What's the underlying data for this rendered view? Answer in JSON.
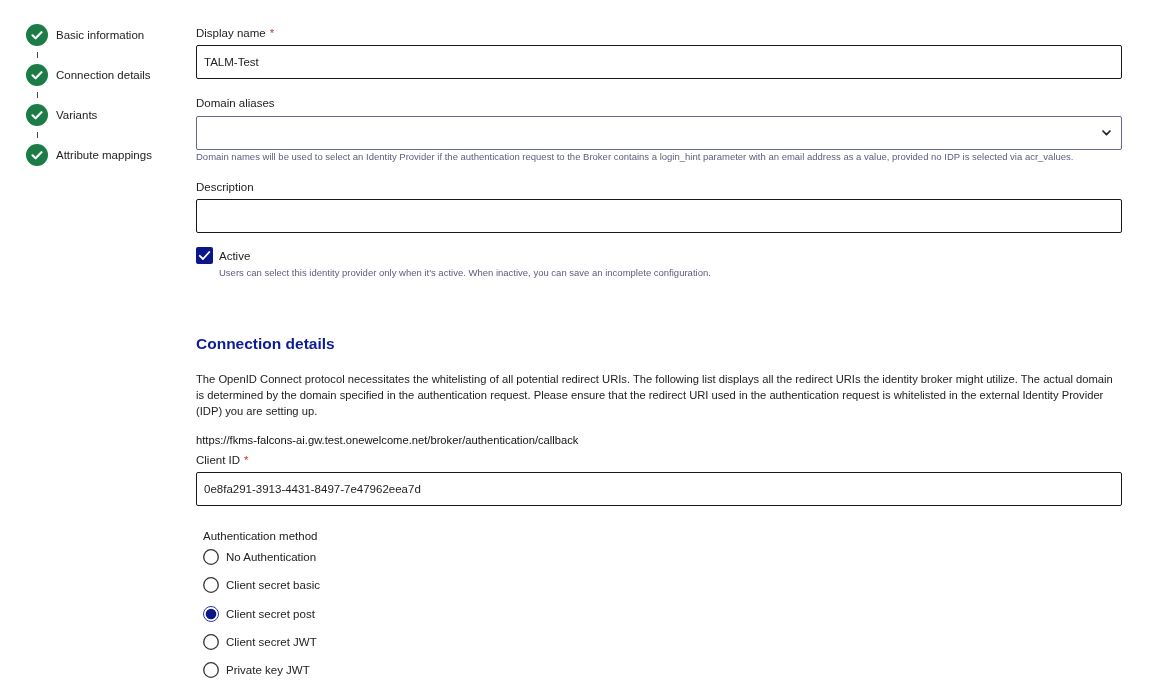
{
  "stepper": {
    "steps": [
      {
        "label": "Basic information",
        "completed": true
      },
      {
        "label": "Connection details",
        "completed": true
      },
      {
        "label": "Variants",
        "completed": true
      },
      {
        "label": "Attribute mappings",
        "completed": true
      }
    ]
  },
  "basic_information": {
    "fields": [
      {
        "kind": "text",
        "label": "Display name",
        "required_mark": "*",
        "value": "TALM-Test"
      },
      {
        "kind": "select",
        "label": "Domain aliases",
        "hint": "Domain names will be used to select an Identity Provider if the authentication request to the Broker contains a login_hint parameter with an email address as a value, provided no IDP is selected via acr_values."
      },
      {
        "kind": "text",
        "label": "Description"
      }
    ],
    "active": {
      "label": "Active",
      "checked": true,
      "hint": "Users can select this identity provider only when it's active. When inactive, you can save an incomplete configuration."
    }
  },
  "connection_details": {
    "heading": "Connection details",
    "description": "The OpenID Connect protocol necessitates the whitelisting of all potential redirect URIs. The following list displays all the redirect URIs the identity broker might utilize. The actual domain is determined by the domain specified in the authentication request. Please ensure that the redirect URI used in the authentication request is whitelisted in the external Identity Provider (IDP) you are setting up.",
    "redirect_uri": "https://fkms-falcons-ai.gw.test.onewelcome.net/broker/authentication/callback",
    "client_id": {
      "kind": "text",
      "label": "Client ID",
      "required_mark": "*",
      "value": "0e8fa291-3913-4431-8497-7e47962eea7d"
    },
    "authentication_method": {
      "label": "Authentication method",
      "options": [
        {
          "label": "No Authentication",
          "selected": false
        },
        {
          "label": "Client secret basic",
          "selected": false
        },
        {
          "label": "Client secret post",
          "selected": true
        },
        {
          "label": "Client secret JWT",
          "selected": false
        },
        {
          "label": "Private key JWT",
          "selected": false
        }
      ]
    }
  }
}
